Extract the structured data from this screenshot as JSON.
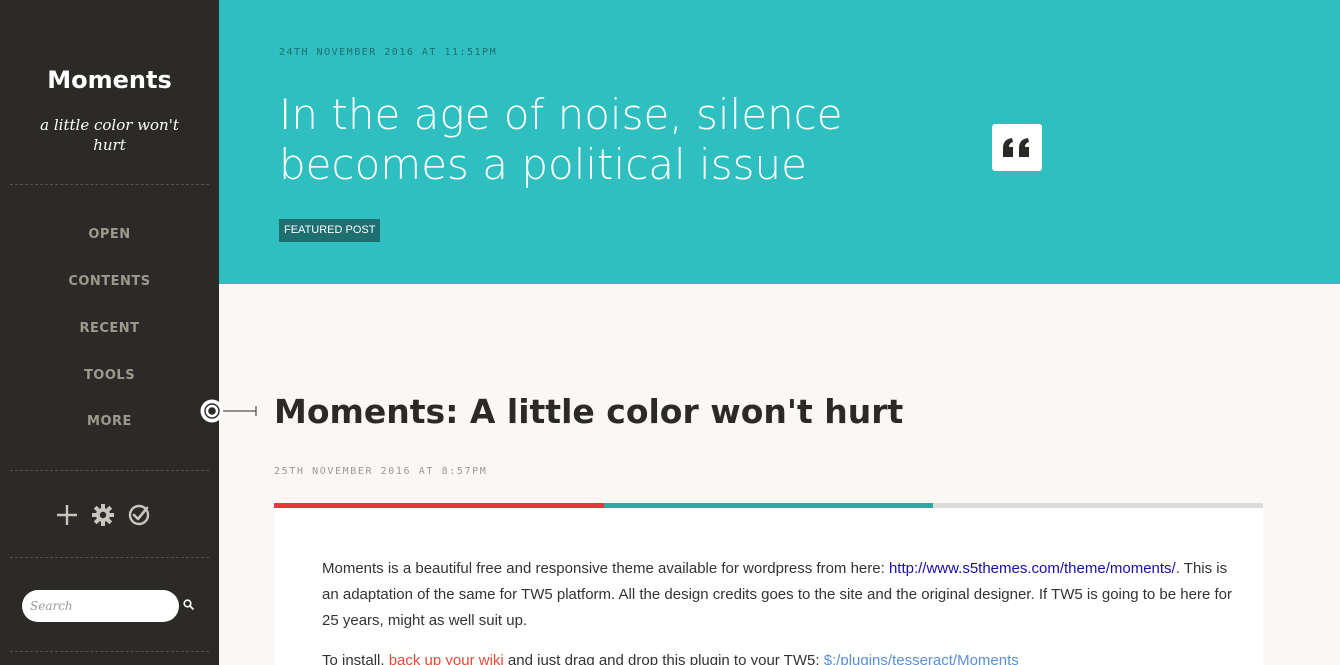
{
  "sidebar": {
    "title": "Moments",
    "subtitle": "a little color won't hurt",
    "nav": [
      {
        "label": "OPEN"
      },
      {
        "label": "CONTENTS"
      },
      {
        "label": "RECENT"
      },
      {
        "label": "TOOLS"
      },
      {
        "label": "MORE"
      }
    ],
    "tools": [
      "plus-icon",
      "gear-icon",
      "check-circle-icon"
    ],
    "search": {
      "placeholder": "Search",
      "value": ""
    }
  },
  "hero": {
    "date": "24TH NOVEMBER 2016 AT 11:51PM",
    "title": "In the age of noise, silence becomes a political issue",
    "badge": "FEATURED POST",
    "icon": "quote-icon"
  },
  "post": {
    "title": "Moments: A little color won't hurt",
    "date": "25TH NOVEMBER 2016 AT 8:57PM",
    "bar_colors": [
      "#e4383a",
      "#2aaaa5",
      "#dcdcdc"
    ],
    "p1_text_a": "Moments is a beautiful free and responsive theme available for wordpress from here: ",
    "p1_link": "http://www.s5themes.com/theme/moments/",
    "p1_text_b": ". This is an adaptation of the same for TW5 platform. All the design credits goes to the site and the original designer. If TW5 is going to be here for 25 years, might as well suit up.",
    "p2_text_a": "To install, ",
    "p2_link_a": "back up your wiki",
    "p2_text_b": " and just drag and drop this plugin to your TW5: ",
    "p2_link_b": "$:/plugins/tesseract/Moments"
  },
  "colors": {
    "sidebar_bg": "#2b2a27",
    "hero_bg": "#2fbfc1",
    "badge_bg": "#1d6f71",
    "page_bg": "#f9f8f5"
  }
}
